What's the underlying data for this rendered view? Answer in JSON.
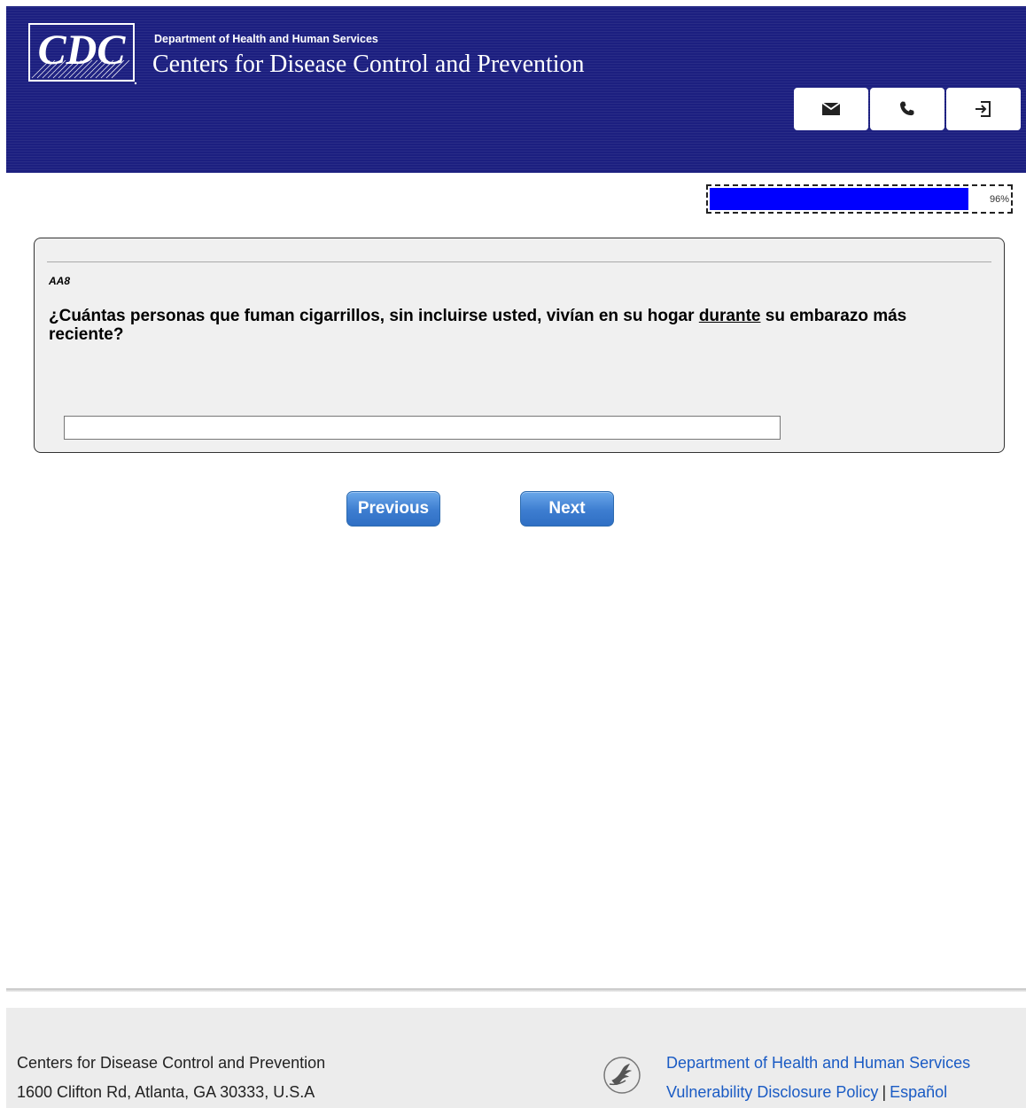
{
  "header": {
    "logo_text": "CDC",
    "department": "Department of Health and Human Services",
    "agency": "Centers for Disease Control and Prevention",
    "actions": [
      {
        "name": "email",
        "icon": "envelope-icon"
      },
      {
        "name": "phone",
        "icon": "phone-icon"
      },
      {
        "name": "exit",
        "icon": "exit-icon"
      }
    ],
    "color": "#1c1f80"
  },
  "progress": {
    "value": 0.96,
    "label": "96%",
    "fill_color": "#0000ff"
  },
  "question": {
    "code": "AA8",
    "text_before": "¿Cuántas personas que fuman cigarrillos, sin incluirse usted, vivían en su hogar ",
    "text_underlined": "durante",
    "text_after": " su embarazo más reciente?",
    "answer_value": ""
  },
  "navigation": {
    "previous_label": "Previous",
    "next_label": "Next"
  },
  "footer": {
    "address_line1": "Centers for Disease Control and Prevention",
    "address_line2": "1600 Clifton Rd, Atlanta, GA 30333, U.S.A",
    "link_hhs": "Department of Health and Human Services",
    "link_vdp": "Vulnerability Disclosure Policy",
    "separator": "|",
    "link_espanol": "Español",
    "link_color": "#1a5bc4"
  }
}
